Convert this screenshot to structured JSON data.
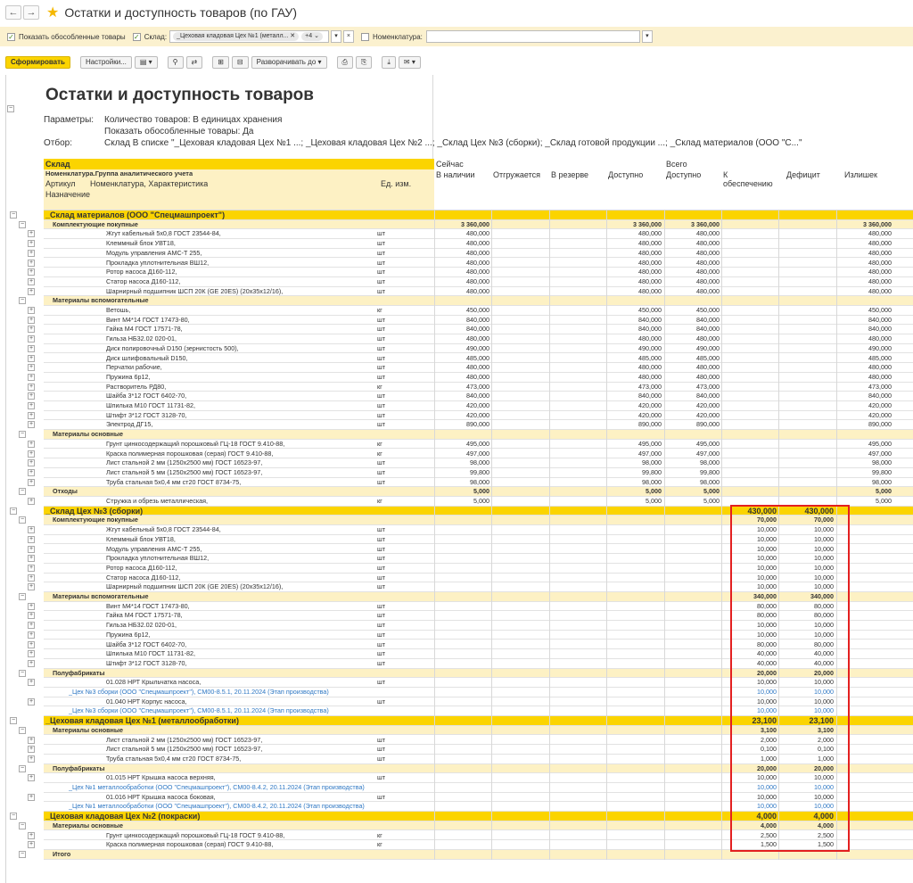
{
  "window": {
    "title": "Остатки и доступность товаров (по ГАУ)"
  },
  "filters": {
    "show_isolated": "Показать обособленные товары",
    "warehouse_label": "Склад:",
    "warehouse_tag": "_Цеховая кладовая Цех №1 (металл...",
    "warehouse_more": "+4",
    "nomenclature_label": "Номенклатура:"
  },
  "toolbar": {
    "generate": "Сформировать",
    "settings": "Настройки...",
    "expand": "Разворачивать до"
  },
  "report": {
    "title": "Остатки и доступность товаров",
    "params_label": "Параметры:",
    "param1": "Количество товаров: В единицах хранения",
    "param2": "Показать обособленные товары: Да",
    "filter_label": "Отбор:",
    "filter_value": "Склад В списке \"_Цеховая кладовая Цех №1 ...; _Цеховая кладовая Цех №2 ...; _Склад Цех №3 (сборки); _Склад готовой продукции ...; _Склад материалов (ООО \"С...\""
  },
  "headers": {
    "warehouse": "Склад",
    "now": "Сейчас",
    "total": "Всего",
    "nom_group": "Номенклатура.Группа аналитического учета",
    "in_stock": "В наличии",
    "shipping": "Отгружается",
    "reserved": "В резерве",
    "available": "Доступно",
    "available2": "Доступно",
    "to_provide": "К обеспечению",
    "deficit": "Дефицит",
    "surplus": "Излишек",
    "article": "Артикул",
    "nomenclature": "Номенклатура, Характеристика",
    "unit": "Ед. изм.",
    "purpose": "Назначение"
  },
  "rows": [
    {
      "t": "wh",
      "name": "_Склад материалов (ООО \"Спецмашпроект\")"
    },
    {
      "t": "grp",
      "name": "Комплектующие покупные",
      "v": [
        "3 360,000",
        "",
        "",
        "3 360,000",
        "3 360,000",
        "",
        "",
        "3 360,000"
      ]
    },
    {
      "t": "itm",
      "name": "Жгут кабельный 5х0,8 ГОСТ 23544-84,",
      "u": "шт",
      "v": [
        "480,000",
        "",
        "",
        "480,000",
        "480,000",
        "",
        "",
        "480,000"
      ]
    },
    {
      "t": "itm",
      "name": "Клеммный блок УВТ18,",
      "u": "шт",
      "v": [
        "480,000",
        "",
        "",
        "480,000",
        "480,000",
        "",
        "",
        "480,000"
      ]
    },
    {
      "t": "itm",
      "name": "Модуль управления АМС-Т 255,",
      "u": "шт",
      "v": [
        "480,000",
        "",
        "",
        "480,000",
        "480,000",
        "",
        "",
        "480,000"
      ]
    },
    {
      "t": "itm",
      "name": "Прокладка уплотнительная ВШ12,",
      "u": "шт",
      "v": [
        "480,000",
        "",
        "",
        "480,000",
        "480,000",
        "",
        "",
        "480,000"
      ]
    },
    {
      "t": "itm",
      "name": "Ротор насоса Д160-112,",
      "u": "шт",
      "v": [
        "480,000",
        "",
        "",
        "480,000",
        "480,000",
        "",
        "",
        "480,000"
      ]
    },
    {
      "t": "itm",
      "name": "Статор насоса Д160-112,",
      "u": "шт",
      "v": [
        "480,000",
        "",
        "",
        "480,000",
        "480,000",
        "",
        "",
        "480,000"
      ]
    },
    {
      "t": "itm",
      "name": "Шарнирный подшипник ШСП 20К (GE 20ES) (20x35x12/16),",
      "u": "шт",
      "v": [
        "480,000",
        "",
        "",
        "480,000",
        "480,000",
        "",
        "",
        "480,000"
      ]
    },
    {
      "t": "grp",
      "name": "Материалы вспомогательные"
    },
    {
      "t": "itm",
      "name": "Ветошь,",
      "u": "кг",
      "v": [
        "450,000",
        "",
        "",
        "450,000",
        "450,000",
        "",
        "",
        "450,000"
      ]
    },
    {
      "t": "itm",
      "name": "Винт М4*14 ГОСТ 17473-80,",
      "u": "шт",
      "v": [
        "840,000",
        "",
        "",
        "840,000",
        "840,000",
        "",
        "",
        "840,000"
      ]
    },
    {
      "t": "itm",
      "name": "Гайка М4 ГОСТ 17571-78,",
      "u": "шт",
      "v": [
        "840,000",
        "",
        "",
        "840,000",
        "840,000",
        "",
        "",
        "840,000"
      ]
    },
    {
      "t": "itm",
      "name": "Гильза НБ32.02 020-01,",
      "u": "шт",
      "v": [
        "480,000",
        "",
        "",
        "480,000",
        "480,000",
        "",
        "",
        "480,000"
      ]
    },
    {
      "t": "itm",
      "name": "Диск полировочный D150 (зернистость 500),",
      "u": "шт",
      "v": [
        "490,000",
        "",
        "",
        "490,000",
        "490,000",
        "",
        "",
        "490,000"
      ]
    },
    {
      "t": "itm",
      "name": "Диск шлифовальный D150,",
      "u": "шт",
      "v": [
        "485,000",
        "",
        "",
        "485,000",
        "485,000",
        "",
        "",
        "485,000"
      ]
    },
    {
      "t": "itm",
      "name": "Перчатки рабочие,",
      "u": "шт",
      "v": [
        "480,000",
        "",
        "",
        "480,000",
        "480,000",
        "",
        "",
        "480,000"
      ]
    },
    {
      "t": "itm",
      "name": "Пружина 6р12,",
      "u": "шт",
      "v": [
        "480,000",
        "",
        "",
        "480,000",
        "480,000",
        "",
        "",
        "480,000"
      ]
    },
    {
      "t": "itm",
      "name": "Растворитель РД80,",
      "u": "кг",
      "v": [
        "473,000",
        "",
        "",
        "473,000",
        "473,000",
        "",
        "",
        "473,000"
      ]
    },
    {
      "t": "itm",
      "name": "Шайба 3*12 ГОСТ 6402-70,",
      "u": "шт",
      "v": [
        "840,000",
        "",
        "",
        "840,000",
        "840,000",
        "",
        "",
        "840,000"
      ]
    },
    {
      "t": "itm",
      "name": "Шпилька М10 ГОСТ 11731-82,",
      "u": "шт",
      "v": [
        "420,000",
        "",
        "",
        "420,000",
        "420,000",
        "",
        "",
        "420,000"
      ]
    },
    {
      "t": "itm",
      "name": "Штифт 3*12 ГОСТ 3128-70,",
      "u": "шт",
      "v": [
        "420,000",
        "",
        "",
        "420,000",
        "420,000",
        "",
        "",
        "420,000"
      ]
    },
    {
      "t": "itm",
      "name": "Электрод ДГ15,",
      "u": "шт",
      "v": [
        "890,000",
        "",
        "",
        "890,000",
        "890,000",
        "",
        "",
        "890,000"
      ]
    },
    {
      "t": "grp",
      "name": "Материалы основные"
    },
    {
      "t": "itm",
      "name": "Грунт цинкосодержащий порошковый ГЦ-18 ГОСТ 9.410-88,",
      "u": "кг",
      "v": [
        "495,000",
        "",
        "",
        "495,000",
        "495,000",
        "",
        "",
        "495,000"
      ]
    },
    {
      "t": "itm",
      "name": "Краска полимерная порошковая (серая) ГОСТ 9.410-88,",
      "u": "кг",
      "v": [
        "497,000",
        "",
        "",
        "497,000",
        "497,000",
        "",
        "",
        "497,000"
      ]
    },
    {
      "t": "itm",
      "name": "Лист стальной 2 мм (1250х2500 мм) ГОСТ 16523-97,",
      "u": "шт",
      "v": [
        "98,000",
        "",
        "",
        "98,000",
        "98,000",
        "",
        "",
        "98,000"
      ]
    },
    {
      "t": "itm",
      "name": "Лист стальной 5 мм (1250х2500 мм) ГОСТ 16523-97,",
      "u": "шт",
      "v": [
        "99,800",
        "",
        "",
        "99,800",
        "99,800",
        "",
        "",
        "99,800"
      ]
    },
    {
      "t": "itm",
      "name": "Труба стальная 5х0,4 мм ст20 ГОСТ 8734-75,",
      "u": "шт",
      "v": [
        "98,000",
        "",
        "",
        "98,000",
        "98,000",
        "",
        "",
        "98,000"
      ]
    },
    {
      "t": "grp",
      "name": "Отходы",
      "v": [
        "5,000",
        "",
        "",
        "5,000",
        "5,000",
        "",
        "",
        "5,000"
      ]
    },
    {
      "t": "itm",
      "name": "Стружка и обрезь металлическая,",
      "u": "кг",
      "v": [
        "5,000",
        "",
        "",
        "5,000",
        "5,000",
        "",
        "",
        "5,000"
      ]
    },
    {
      "t": "wh",
      "name": "_Склад Цех №3 (сборки)",
      "v": [
        "",
        "",
        "",
        "",
        "",
        "430,000",
        "430,000",
        ""
      ]
    },
    {
      "t": "grp",
      "name": "Комплектующие покупные",
      "v": [
        "",
        "",
        "",
        "",
        "",
        "70,000",
        "70,000",
        ""
      ]
    },
    {
      "t": "itm",
      "name": "Жгут кабельный 5х0,8 ГОСТ 23544-84,",
      "u": "шт",
      "v": [
        "",
        "",
        "",
        "",
        "",
        "10,000",
        "10,000",
        ""
      ]
    },
    {
      "t": "itm",
      "name": "Клеммный блок УВТ18,",
      "u": "шт",
      "v": [
        "",
        "",
        "",
        "",
        "",
        "10,000",
        "10,000",
        ""
      ]
    },
    {
      "t": "itm",
      "name": "Модуль управления АМС-Т 255,",
      "u": "шт",
      "v": [
        "",
        "",
        "",
        "",
        "",
        "10,000",
        "10,000",
        ""
      ]
    },
    {
      "t": "itm",
      "name": "Прокладка уплотнительная ВШ12,",
      "u": "шт",
      "v": [
        "",
        "",
        "",
        "",
        "",
        "10,000",
        "10,000",
        ""
      ]
    },
    {
      "t": "itm",
      "name": "Ротор насоса Д160-112,",
      "u": "шт",
      "v": [
        "",
        "",
        "",
        "",
        "",
        "10,000",
        "10,000",
        ""
      ]
    },
    {
      "t": "itm",
      "name": "Статор насоса Д160-112,",
      "u": "шт",
      "v": [
        "",
        "",
        "",
        "",
        "",
        "10,000",
        "10,000",
        ""
      ]
    },
    {
      "t": "itm",
      "name": "Шарнирный подшипник ШСП 20К (GE 20ES) (20x35x12/16),",
      "u": "шт",
      "v": [
        "",
        "",
        "",
        "",
        "",
        "10,000",
        "10,000",
        ""
      ]
    },
    {
      "t": "grp",
      "name": "Материалы вспомогательные",
      "v": [
        "",
        "",
        "",
        "",
        "",
        "340,000",
        "340,000",
        ""
      ]
    },
    {
      "t": "itm",
      "name": "Винт М4*14 ГОСТ 17473-80,",
      "u": "шт",
      "v": [
        "",
        "",
        "",
        "",
        "",
        "80,000",
        "80,000",
        ""
      ]
    },
    {
      "t": "itm",
      "name": "Гайка М4 ГОСТ 17571-78,",
      "u": "шт",
      "v": [
        "",
        "",
        "",
        "",
        "",
        "80,000",
        "80,000",
        ""
      ]
    },
    {
      "t": "itm",
      "name": "Гильза НБ32.02 020-01,",
      "u": "шт",
      "v": [
        "",
        "",
        "",
        "",
        "",
        "10,000",
        "10,000",
        ""
      ]
    },
    {
      "t": "itm",
      "name": "Пружина 6р12,",
      "u": "шт",
      "v": [
        "",
        "",
        "",
        "",
        "",
        "10,000",
        "10,000",
        ""
      ]
    },
    {
      "t": "itm",
      "name": "Шайба 3*12 ГОСТ 6402-70,",
      "u": "шт",
      "v": [
        "",
        "",
        "",
        "",
        "",
        "80,000",
        "80,000",
        ""
      ]
    },
    {
      "t": "itm",
      "name": "Шпилька М10 ГОСТ 11731-82,",
      "u": "шт",
      "v": [
        "",
        "",
        "",
        "",
        "",
        "40,000",
        "40,000",
        ""
      ]
    },
    {
      "t": "itm",
      "name": "Штифт 3*12 ГОСТ 3128-70,",
      "u": "шт",
      "v": [
        "",
        "",
        "",
        "",
        "",
        "40,000",
        "40,000",
        ""
      ]
    },
    {
      "t": "grp",
      "name": "Полуфабрикаты",
      "v": [
        "",
        "",
        "",
        "",
        "",
        "20,000",
        "20,000",
        ""
      ]
    },
    {
      "t": "itm",
      "name": "01.028 НРТ Крыльчатка насоса,",
      "u": "шт",
      "v": [
        "",
        "",
        "",
        "",
        "",
        "10,000",
        "10,000",
        ""
      ]
    },
    {
      "t": "sub",
      "name": "_Цех №3 сборки (ООО \"Спецмашпроект\"), СМ00-8.5.1, 20.11.2024 (Этап производства)",
      "v": [
        "",
        "",
        "",
        "",
        "",
        "10,000",
        "10,000",
        ""
      ]
    },
    {
      "t": "itm",
      "name": "01.040 НРТ Корпус насоса,",
      "u": "шт",
      "v": [
        "",
        "",
        "",
        "",
        "",
        "10,000",
        "10,000",
        ""
      ]
    },
    {
      "t": "sub",
      "name": "_Цех №3 сборки (ООО \"Спецмашпроект\"), СМ00-8.5.1, 20.11.2024 (Этап производства)",
      "v": [
        "",
        "",
        "",
        "",
        "",
        "10,000",
        "10,000",
        ""
      ]
    },
    {
      "t": "wh",
      "name": "_Цеховая кладовая Цех №1 (металлообработки)",
      "v": [
        "",
        "",
        "",
        "",
        "",
        "23,100",
        "23,100",
        ""
      ]
    },
    {
      "t": "grp",
      "name": "Материалы основные",
      "v": [
        "",
        "",
        "",
        "",
        "",
        "3,100",
        "3,100",
        ""
      ]
    },
    {
      "t": "itm",
      "name": "Лист стальной 2 мм (1250х2500 мм) ГОСТ 16523-97,",
      "u": "шт",
      "v": [
        "",
        "",
        "",
        "",
        "",
        "2,000",
        "2,000",
        ""
      ]
    },
    {
      "t": "itm",
      "name": "Лист стальной 5 мм (1250х2500 мм) ГОСТ 16523-97,",
      "u": "шт",
      "v": [
        "",
        "",
        "",
        "",
        "",
        "0,100",
        "0,100",
        ""
      ]
    },
    {
      "t": "itm",
      "name": "Труба стальная 5х0,4 мм ст20 ГОСТ 8734-75,",
      "u": "шт",
      "v": [
        "",
        "",
        "",
        "",
        "",
        "1,000",
        "1,000",
        ""
      ]
    },
    {
      "t": "grp",
      "name": "Полуфабрикаты",
      "v": [
        "",
        "",
        "",
        "",
        "",
        "20,000",
        "20,000",
        ""
      ]
    },
    {
      "t": "itm",
      "name": "01.015 НРТ Крышка насоса верхняя,",
      "u": "шт",
      "v": [
        "",
        "",
        "",
        "",
        "",
        "10,000",
        "10,000",
        ""
      ]
    },
    {
      "t": "sub",
      "name": "_Цех №1 металлообработки (ООО \"Спецмашпроект\"), СМ00-8.4.2, 20.11.2024 (Этап производства)",
      "v": [
        "",
        "",
        "",
        "",
        "",
        "10,000",
        "10,000",
        ""
      ]
    },
    {
      "t": "itm",
      "name": "01.016 НРТ Крышка насоса боковая,",
      "u": "шт",
      "v": [
        "",
        "",
        "",
        "",
        "",
        "10,000",
        "10,000",
        ""
      ]
    },
    {
      "t": "sub",
      "name": "_Цех №1 металлообработки (ООО \"Спецмашпроект\"), СМ00-8.4.2, 20.11.2024 (Этап производства)",
      "v": [
        "",
        "",
        "",
        "",
        "",
        "10,000",
        "10,000",
        ""
      ]
    },
    {
      "t": "wh",
      "name": "_Цеховая кладовая Цех №2 (покраски)",
      "v": [
        "",
        "",
        "",
        "",
        "",
        "4,000",
        "4,000",
        ""
      ]
    },
    {
      "t": "grp",
      "name": "Материалы основные",
      "v": [
        "",
        "",
        "",
        "",
        "",
        "4,000",
        "4,000",
        ""
      ]
    },
    {
      "t": "itm",
      "name": "Грунт цинкосодержащий порошковый ГЦ-18 ГОСТ 9.410-88,",
      "u": "кг",
      "v": [
        "",
        "",
        "",
        "",
        "",
        "2,500",
        "2,500",
        ""
      ]
    },
    {
      "t": "itm",
      "name": "Краска полимерная порошковая (серая) ГОСТ 9.410-88,",
      "u": "кг",
      "v": [
        "",
        "",
        "",
        "",
        "",
        "1,500",
        "1,500",
        ""
      ]
    },
    {
      "t": "grp",
      "name": "Итого"
    }
  ]
}
